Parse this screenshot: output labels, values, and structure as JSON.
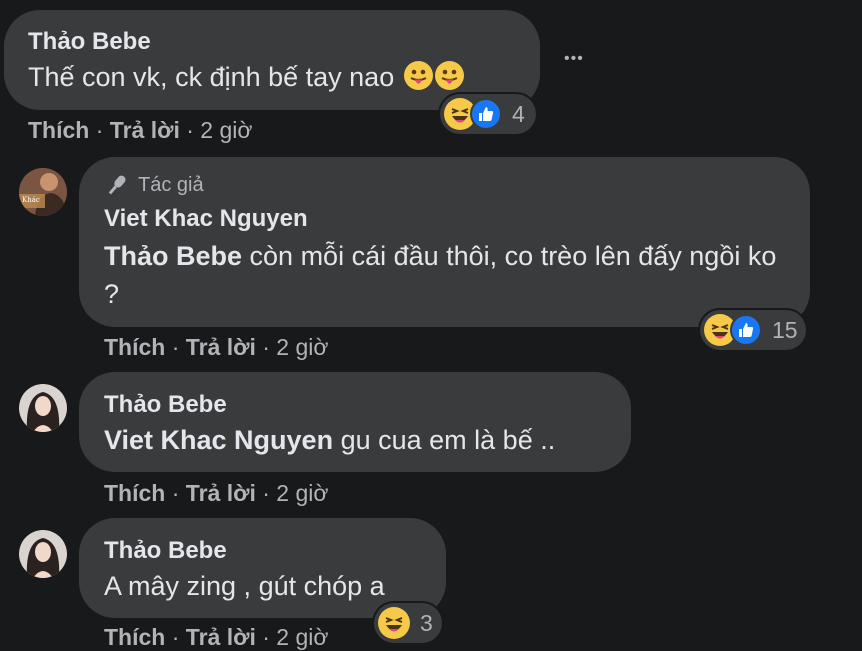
{
  "comment1": {
    "author": "Thảo Bebe",
    "text": "Thế con vk, ck định bế tay nao",
    "reactions_count": "4",
    "like_label": "Thích",
    "reply_label": "Trả lời",
    "time": "2 giờ",
    "more_label": "•••"
  },
  "comment2": {
    "badge": "Tác giả",
    "author": "Viet Khac Nguyen",
    "mention": "Thảo Bebe",
    "text": " còn mỗi cái đầu thôi, co trèo lên đấy ngồi ko ?",
    "reactions_count": "15",
    "like_label": "Thích",
    "reply_label": "Trả lời",
    "time": "2 giờ"
  },
  "comment3": {
    "author": "Thảo Bebe",
    "mention": "Viet Khac Nguyen",
    "text": " gu cua em là bế ..",
    "like_label": "Thích",
    "reply_label": "Trả lời",
    "time": "2 giờ"
  },
  "comment4": {
    "author": "Thảo Bebe",
    "text": "A mây zing , gút chóp a",
    "reactions_count": "3",
    "like_label": "Thích",
    "reply_label": "Trả lời",
    "time": "2 giờ"
  },
  "colors": {
    "background": "#18191a",
    "bubble": "#3a3b3c",
    "primary_text": "#e4e6eb",
    "secondary_text": "#b0b3b8",
    "like_blue": "#1877f2",
    "emoji_yellow": "#f7c948"
  }
}
